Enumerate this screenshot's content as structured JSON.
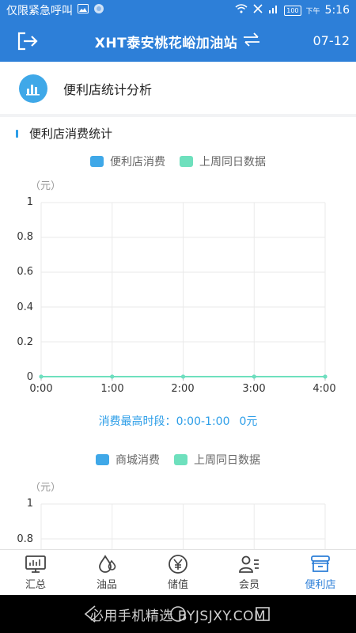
{
  "status_bar": {
    "carrier": "仅限紧急呼叫",
    "ampm": "下午",
    "time": "5:16",
    "battery": "100"
  },
  "header": {
    "title": "XHT泰安桃花峪加油站",
    "date": "07-12"
  },
  "section": {
    "label": "便利店统计分析"
  },
  "stats_card": {
    "title": "便利店消费统计"
  },
  "chart_data": [
    {
      "type": "line",
      "legend": [
        "便利店消费",
        "上周同日数据"
      ],
      "unit": "（元）",
      "x": [
        "0:00",
        "1:00",
        "2:00",
        "3:00",
        "4:00"
      ],
      "y_ticks": [
        "1",
        "0.8",
        "0.6",
        "0.4",
        "0.2",
        "0"
      ],
      "ylim": [
        0,
        1
      ],
      "series": [
        {
          "name": "便利店消费",
          "values": [
            0,
            0,
            0,
            0,
            0
          ]
        },
        {
          "name": "上周同日数据",
          "values": [
            0,
            0,
            0,
            0,
            0
          ]
        }
      ],
      "peak_label": "消费最高时段：",
      "peak_period": "0:00-1:00",
      "peak_value": "0元"
    },
    {
      "type": "line",
      "legend": [
        "商城消费",
        "上周同日数据"
      ],
      "unit": "（元）",
      "y_ticks": [
        "1",
        "0.8"
      ],
      "ylim": [
        0,
        1
      ]
    }
  ],
  "colors": {
    "primary": "#2d7fd8",
    "series_current": "#3fa8e8",
    "series_last_week": "#6ee0bd"
  },
  "tabs": [
    {
      "label": "汇总",
      "icon": "monitor-icon"
    },
    {
      "label": "油品",
      "icon": "oil-drop-icon"
    },
    {
      "label": "储值",
      "icon": "yen-icon"
    },
    {
      "label": "会员",
      "icon": "member-icon"
    },
    {
      "label": "便利店",
      "icon": "store-icon"
    }
  ],
  "watermark": "必用手机精选 BYJSJXY.COM"
}
